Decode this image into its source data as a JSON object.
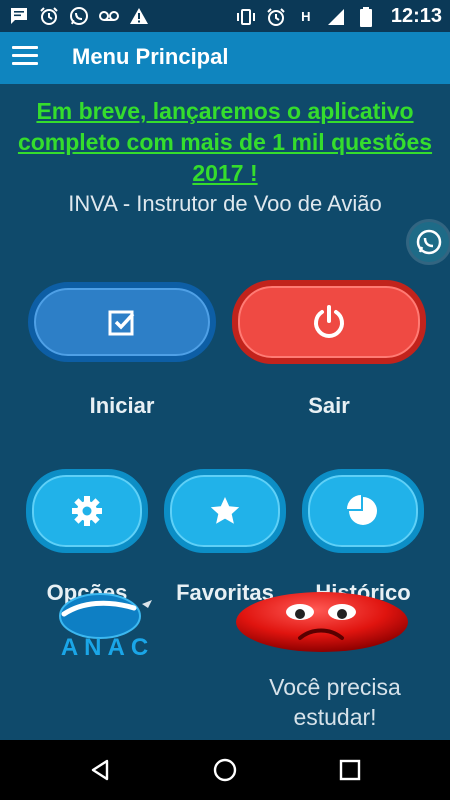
{
  "status_bar": {
    "time": "12:13",
    "left_icons": [
      "message-icon",
      "alarm-icon",
      "whatsapp-icon",
      "voicemail-icon",
      "warning-icon"
    ],
    "right_icons": [
      "vibrate-icon",
      "alarm-icon",
      "h-network-icon",
      "signal-icon",
      "battery-icon"
    ],
    "network_label": "H"
  },
  "app_bar": {
    "title": "Menu Principal"
  },
  "promo": {
    "text": "Em breve, lançaremos o aplicativo completo com mais de 1 mil questões 2017 !"
  },
  "subtitle": "INVA - Instrutor de Voo de Avião",
  "buttons": {
    "start": "Iniciar",
    "exit": "Sair",
    "options": "Opções",
    "favorites": "Favoritas",
    "history": "Histórico"
  },
  "logo": {
    "text": "ANAC"
  },
  "advice": "Você precisa estudar!",
  "colors": {
    "background": "#0f4a6b",
    "app_bar": "#0f85bf",
    "promo_text": "#35dd2d",
    "start_button": "#2d7fc7",
    "exit_button": "#ef4a43",
    "small_buttons": "#21b2e9"
  }
}
